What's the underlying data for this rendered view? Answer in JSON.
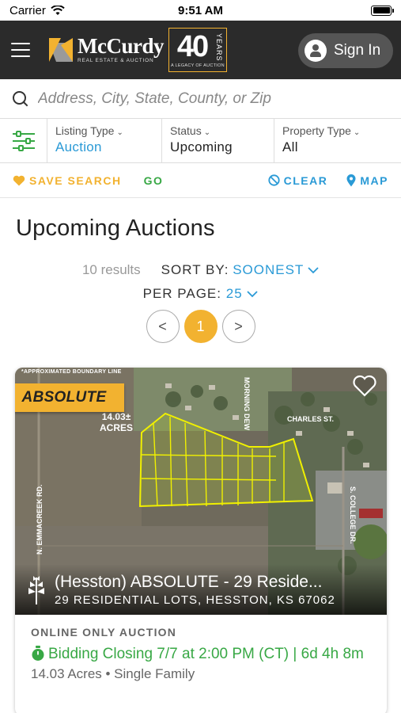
{
  "status_bar": {
    "carrier": "Carrier",
    "time": "9:51 AM"
  },
  "header": {
    "brand_name": "McCurdy",
    "brand_sub": "REAL ESTATE & AUCTION",
    "anniv_number": "40",
    "anniv_word": "YEARS",
    "anniv_tagline": "A LEGACY OF AUCTION",
    "sign_in_label": "Sign In"
  },
  "search": {
    "placeholder": "Address, City, State, County, or Zip"
  },
  "filters": [
    {
      "label": "Listing Type",
      "value": "Auction",
      "highlight": true
    },
    {
      "label": "Status",
      "value": "Upcoming",
      "highlight": false
    },
    {
      "label": "Property Type",
      "value": "All",
      "highlight": false
    }
  ],
  "actions": {
    "save_search": "SAVE SEARCH",
    "go": "GO",
    "clear": "CLEAR",
    "map": "MAP"
  },
  "page_title": "Upcoming Auctions",
  "results": {
    "count_text": "10 results",
    "sort_label": "SORT BY:",
    "sort_value": "SOONEST",
    "per_page_label": "PER PAGE:",
    "per_page_value": "25"
  },
  "pagination": {
    "prev": "<",
    "current": "1",
    "next": ">"
  },
  "listing": {
    "badge": "ABSOLUTE",
    "map_labels": {
      "boundary_note": "*APPROXIMATED BOUNDARY LINE",
      "acres": "14.03±",
      "acres_unit": "ACRES",
      "street_1": "N. EMMACREEK RD.",
      "street_2": "MORNING DEW",
      "street_3": "CHARLES ST.",
      "street_4": "S. COLLEGE DR."
    },
    "title": "(Hesston) ABSOLUTE - 29 Reside...",
    "address": "29 RESIDENTIAL LOTS, HESSTON, KS 67062",
    "auction_type": "ONLINE ONLY AUCTION",
    "closing": "Bidding Closing 7/7 at 2:00 PM (CT) | 6d 4h 8m",
    "meta": "14.03 Acres • Single Family"
  },
  "colors": {
    "accent_gold": "#f2b230",
    "link_blue": "#2a9ad6",
    "success_green": "#38a845",
    "header_bg": "#2b2b2b"
  }
}
